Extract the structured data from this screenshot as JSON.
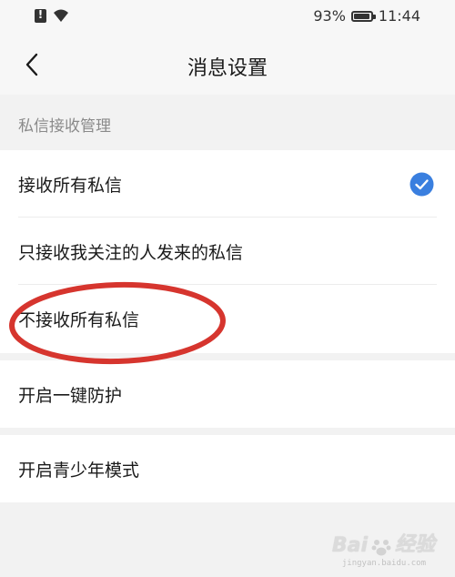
{
  "status_bar": {
    "battery_percent": "93%",
    "battery_level": 0.93,
    "time": "11:44",
    "icons": [
      "sim-alert-icon",
      "wifi-icon",
      "battery-icon"
    ]
  },
  "header": {
    "back_icon": "chevron-left-icon",
    "title": "消息设置"
  },
  "section": {
    "label": "私信接收管理"
  },
  "dm_options": [
    {
      "label": "接收所有私信",
      "selected": true
    },
    {
      "label": "只接收我关注的人发来的私信",
      "selected": false
    },
    {
      "label": "不接收所有私信",
      "selected": false
    }
  ],
  "settings": [
    {
      "label": "开启一键防护"
    },
    {
      "label": "开启青少年模式"
    }
  ],
  "colors": {
    "accent": "#3a7fdf",
    "annotation": "#d6352e",
    "background": "#f2f2f2",
    "card": "#ffffff"
  },
  "watermark": {
    "logo_text": "Bai",
    "logo_text_2": "经验",
    "sub_text": "jingyan.baidu.com"
  }
}
